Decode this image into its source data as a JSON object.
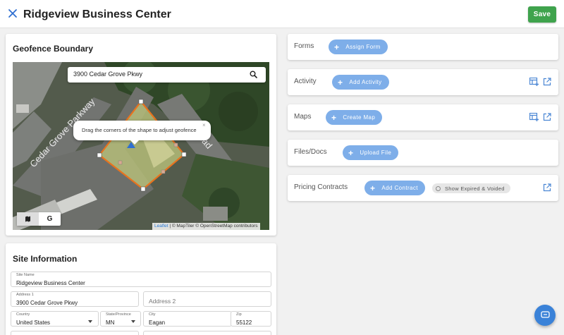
{
  "header": {
    "title": "Ridgeview Business Center",
    "save_label": "Save"
  },
  "geofence": {
    "title": "Geofence Boundary",
    "search_value": "3900 Cedar Grove Pkwy",
    "tooltip": "Drag the corners of the shape to adjust geofence",
    "tooltip_close": "×",
    "map_labels": {
      "street1": "Cedar Grove Parkway",
      "street2": "Road"
    },
    "layer_g": "G",
    "attribution_link": "Leaflet",
    "attribution_text": " | © MapTiler © OpenStreetMap contributors"
  },
  "site_info": {
    "title": "Site Information",
    "site_name_label": "Site Name",
    "site_name": "Ridgeview Business Center",
    "address1_label": "Address 1",
    "address1": "3900 Cedar Grove Pkwy",
    "address2_placeholder": "Address 2",
    "country_label": "Country",
    "country": "United States",
    "state_label": "State/Province",
    "state": "MN",
    "city_label": "City",
    "city": "Eagan",
    "zip_label": "Zip",
    "zip": "55122"
  },
  "panels": {
    "forms": {
      "title": "Forms",
      "button": "Assign Form"
    },
    "activity": {
      "title": "Activity",
      "button": "Add Activity"
    },
    "maps": {
      "title": "Maps",
      "button": "Create Map"
    },
    "files": {
      "title": "Files/Docs",
      "button": "Upload File"
    },
    "contracts": {
      "title": "Pricing Contracts",
      "button": "Add Contract",
      "chip": "Show Expired & Voided"
    }
  },
  "colors": {
    "save": "#3fa34d",
    "accent_button": "#7eaee9",
    "icon_blue": "#4a86d4",
    "geofence_stroke": "#e8731e",
    "fab": "#3a82d8"
  },
  "icons": [
    "close-icon",
    "search-icon",
    "map-layer-icon",
    "table-add-icon",
    "open-external-icon",
    "chat-icon"
  ]
}
